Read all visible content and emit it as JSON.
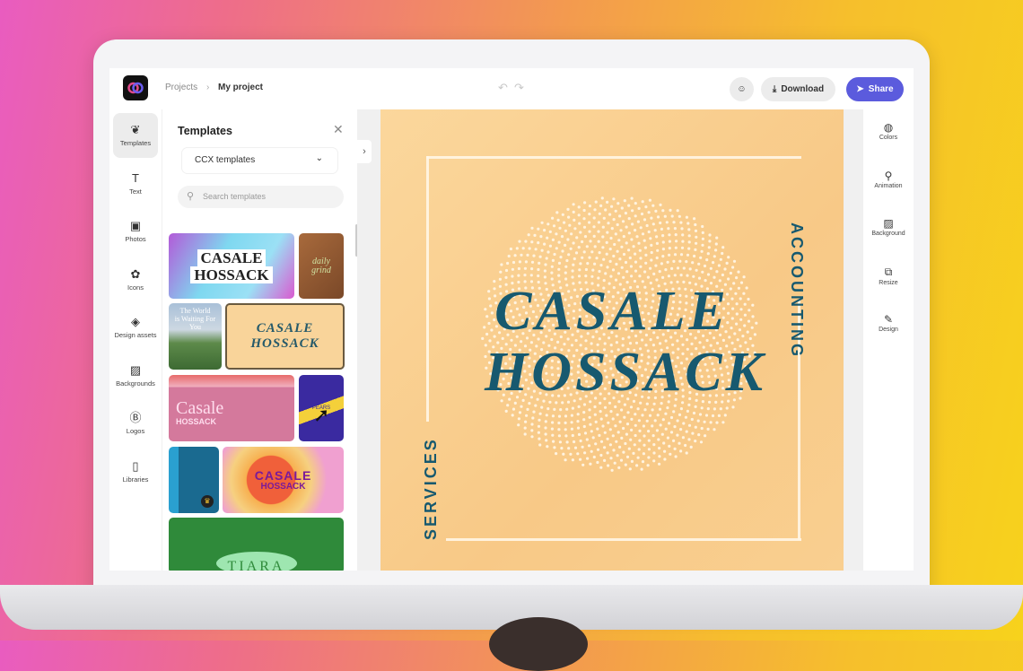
{
  "header": {
    "breadcrumb": [
      "Projects",
      "My project"
    ],
    "download_label": "Download",
    "share_label": "Share",
    "accent": "#5b5bdd"
  },
  "left_rail": {
    "items": [
      {
        "label": "Templates",
        "icon": "templates-icon",
        "glyph": "❦",
        "active": true
      },
      {
        "label": "Text",
        "icon": "text-icon",
        "glyph": "T"
      },
      {
        "label": "Photos",
        "icon": "photos-icon",
        "glyph": "▣"
      },
      {
        "label": "Icons",
        "icon": "icons-icon",
        "glyph": "✿"
      },
      {
        "label": "Design assets",
        "icon": "design-assets-icon",
        "glyph": "◈"
      },
      {
        "label": "Backgrounds",
        "icon": "backgrounds-icon",
        "glyph": "▨"
      },
      {
        "label": "Logos",
        "icon": "logos-icon",
        "glyph": "Ⓑ"
      },
      {
        "label": "Libraries",
        "icon": "libraries-icon",
        "glyph": "▯"
      }
    ]
  },
  "panel": {
    "title": "Templates",
    "dropdown_value": "CCX templates",
    "search_placeholder": "Search templates",
    "thumbnails": [
      {
        "line1": "CASALE",
        "line2": "HOSSACK"
      },
      {
        "line1": "daily",
        "line2": "grind"
      },
      {
        "line1": "The World",
        "line2": "is Waiting For You"
      },
      {
        "line1": "CASALE",
        "line2": "HOSSACK"
      },
      {
        "line1": "Casale",
        "line2": "HOSSACK"
      },
      {
        "line1": "PEARS",
        "line2": ""
      },
      {
        "line1": "",
        "line2": ""
      },
      {
        "line1": "CASALE",
        "line2": "HOSSACK"
      },
      {
        "line1": "TIARA",
        "line2": ""
      }
    ]
  },
  "canvas": {
    "title_line1": "CASALE",
    "title_line2": "HOSSACK",
    "vertical_right": "ACCOUNTING",
    "vertical_left": "SERVICES",
    "background": "#f8cd8e",
    "text_color": "#17596f"
  },
  "right_rail": {
    "items": [
      {
        "label": "Colors",
        "icon": "colors-icon",
        "glyph": "◍"
      },
      {
        "label": "Animation",
        "icon": "animation-icon",
        "glyph": "⚲"
      },
      {
        "label": "Background",
        "icon": "background-icon",
        "glyph": "▨"
      },
      {
        "label": "Resize",
        "icon": "resize-icon",
        "glyph": "⧉"
      },
      {
        "label": "Design",
        "icon": "design-icon",
        "glyph": "✎"
      }
    ]
  }
}
